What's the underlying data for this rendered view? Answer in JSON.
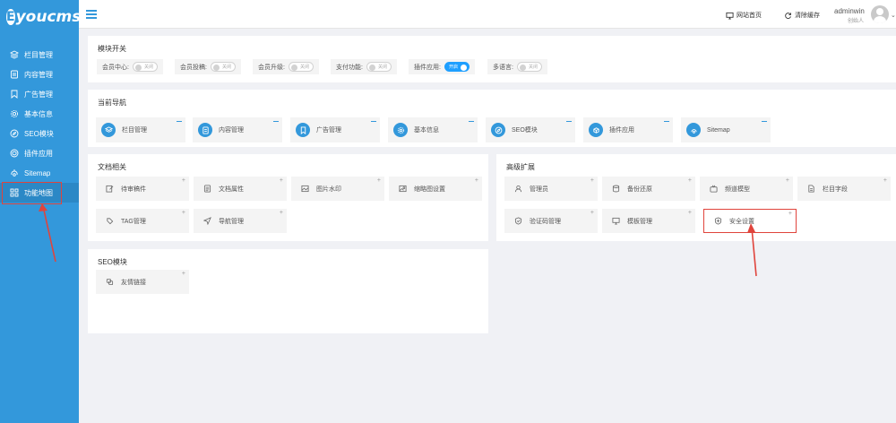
{
  "brand": {
    "logo_letter": "E",
    "logo_text": "youcms"
  },
  "sidebar": {
    "items": [
      {
        "label": "栏目管理",
        "icon": "layers-icon"
      },
      {
        "label": "内容管理",
        "icon": "document-icon"
      },
      {
        "label": "广告管理",
        "icon": "bookmark-icon"
      },
      {
        "label": "基本信息",
        "icon": "gear-icon"
      },
      {
        "label": "SEO模块",
        "icon": "compass-icon"
      },
      {
        "label": "插件应用",
        "icon": "box-icon"
      },
      {
        "label": "Sitemap",
        "icon": "sitemap-icon"
      },
      {
        "label": "功能地图",
        "icon": "grid-icon",
        "active": true
      }
    ]
  },
  "topbar": {
    "home_link": "网站首页",
    "clear_cache": "清除缓存",
    "user_name": "adminwin",
    "user_role": "创始人"
  },
  "switches": {
    "title": "模块开关",
    "items": [
      {
        "label": "会员中心:",
        "state": "关闭",
        "on": false
      },
      {
        "label": "会员投稿:",
        "state": "关闭",
        "on": false
      },
      {
        "label": "会员升级:",
        "state": "关闭",
        "on": false
      },
      {
        "label": "支付功能:",
        "state": "关闭",
        "on": false
      },
      {
        "label": "插件应用:",
        "state": "开启",
        "on": true
      },
      {
        "label": "多语言:",
        "state": "关闭",
        "on": false
      }
    ]
  },
  "current_nav": {
    "title": "当前导航",
    "items": [
      {
        "label": "栏目管理",
        "icon": "layers-icon"
      },
      {
        "label": "内容管理",
        "icon": "document-icon"
      },
      {
        "label": "广告管理",
        "icon": "bookmark-icon"
      },
      {
        "label": "基本信息",
        "icon": "gear-icon"
      },
      {
        "label": "SEO模块",
        "icon": "compass-icon"
      },
      {
        "label": "插件应用",
        "icon": "box-icon"
      },
      {
        "label": "Sitemap",
        "icon": "sitemap-icon"
      }
    ]
  },
  "document": {
    "title": "文档相关",
    "items": [
      {
        "label": "待审稿件",
        "icon": "edit-icon"
      },
      {
        "label": "文档属性",
        "icon": "list-icon"
      },
      {
        "label": "图片水印",
        "icon": "image-icon"
      },
      {
        "label": "缩略图设置",
        "icon": "image-settings-icon"
      },
      {
        "label": "TAG管理",
        "icon": "tag-icon"
      },
      {
        "label": "导航管理",
        "icon": "navigation-icon"
      }
    ]
  },
  "advanced": {
    "title": "高级扩展",
    "items": [
      {
        "label": "管理员",
        "icon": "user-icon"
      },
      {
        "label": "备份还原",
        "icon": "database-icon"
      },
      {
        "label": "频道模型",
        "icon": "tv-icon"
      },
      {
        "label": "栏目字段",
        "icon": "file-icon"
      },
      {
        "label": "验证码管理",
        "icon": "shield-check-icon"
      },
      {
        "label": "模板管理",
        "icon": "monitor-icon"
      },
      {
        "label": "安全设置",
        "icon": "security-icon"
      }
    ]
  },
  "seo": {
    "title": "SEO模块",
    "items": [
      {
        "label": "友情链接",
        "icon": "link-icon"
      }
    ]
  },
  "colors": {
    "sidebar": "#3398db",
    "accent": "#1e9fff",
    "highlight": "#e0443c",
    "background": "#f0f1f5"
  }
}
